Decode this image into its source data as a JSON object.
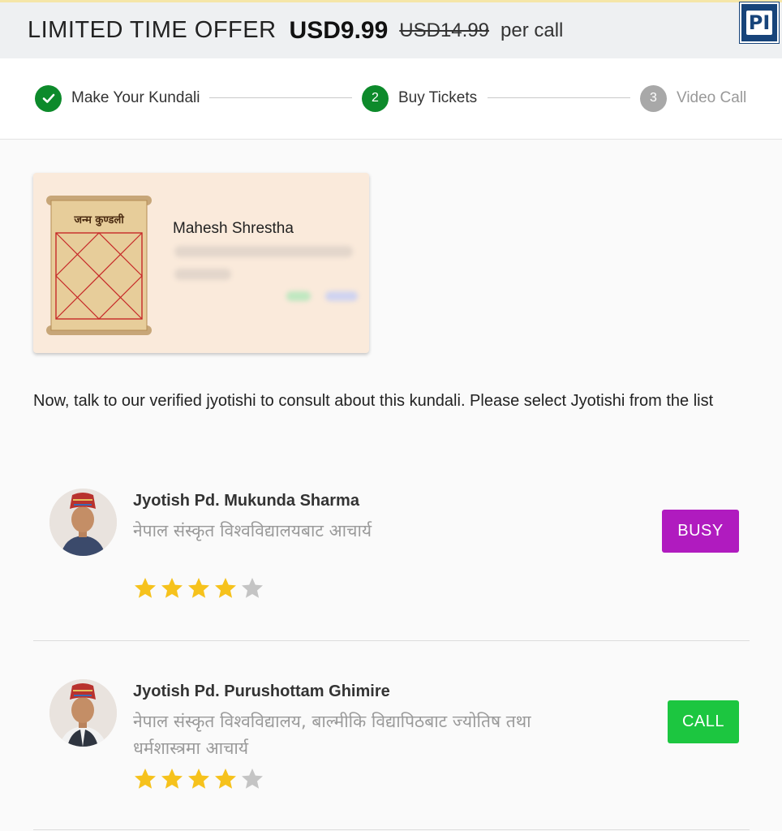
{
  "offer": {
    "label": "LIMITED TIME OFFER",
    "price": "USD9.99",
    "old_price": "USD14.99",
    "per": "per call",
    "logo_text": "PI"
  },
  "stepper": {
    "steps": [
      {
        "number": "1",
        "label": "Make Your Kundali",
        "state": "done"
      },
      {
        "number": "2",
        "label": "Buy Tickets",
        "state": "active"
      },
      {
        "number": "3",
        "label": "Video Call",
        "state": "pending"
      }
    ]
  },
  "kundali": {
    "scroll_title": "जन्म कुण्डली",
    "name": "Mahesh Shrestha"
  },
  "instruction": "Now, talk to our verified jyotishi to consult about this kundali. Please select Jyotishi from the list",
  "jyotishi": [
    {
      "name": "Jyotish Pd. Mukunda Sharma",
      "description": "नेपाल संस्कृत विश्वविद्यालयबाट आचार्य",
      "rating": 4,
      "max_rating": 5,
      "action": "BUSY"
    },
    {
      "name": "Jyotish Pd. Purushottam Ghimire",
      "description": "नेपाल संस्कृत विश्वविद्यालय, बाल्मीकि विद्यापिठबाट ज्योतिष तथा धर्मशास्त्रमा आचार्य",
      "rating": 4,
      "max_rating": 5,
      "action": "CALL"
    }
  ],
  "colors": {
    "step_green": "#0d8a2b",
    "busy": "#b01bbf",
    "call": "#1cc640",
    "star_filled": "#f6c21c",
    "star_empty": "#c4c4c4",
    "kundali_card_bg": "#faeadb",
    "logo_blue": "#17447a"
  }
}
